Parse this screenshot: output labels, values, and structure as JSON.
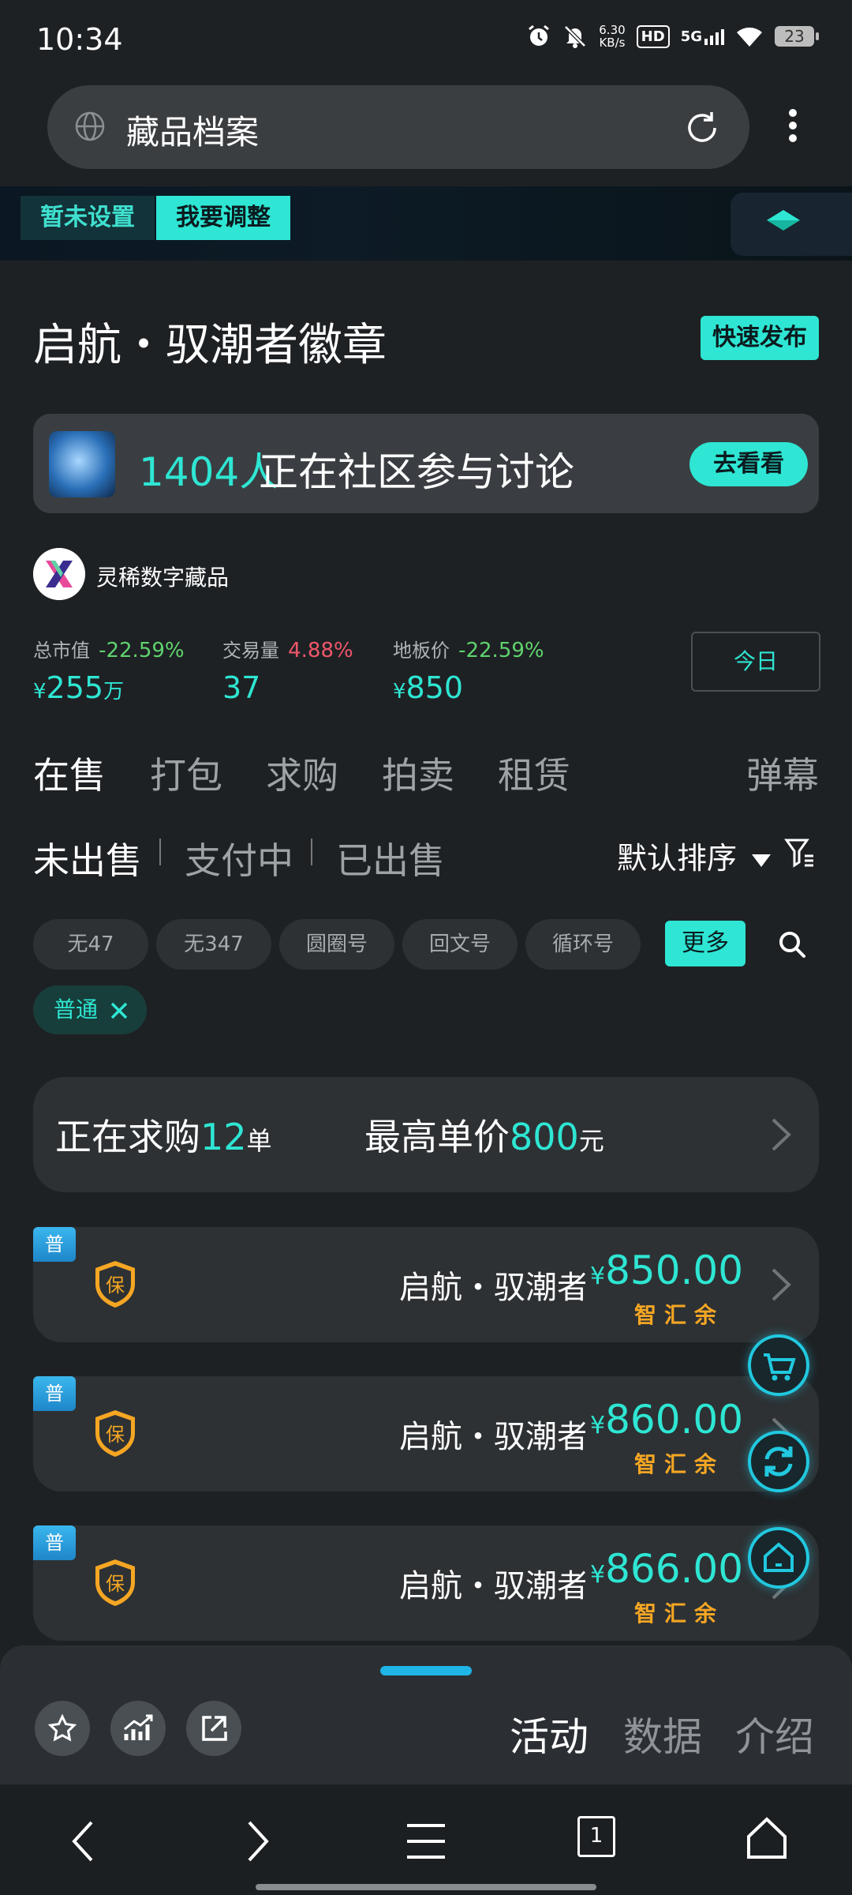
{
  "status_bar": {
    "time": "10:34",
    "net_speed_value": "6.30",
    "net_speed_unit": "KB/s",
    "hd": "HD",
    "signal": "5G",
    "battery": "23",
    "icons": [
      "alarm-icon",
      "mute-icon",
      "hd-icon",
      "5g-signal-icon",
      "wifi-icon",
      "battery-icon"
    ]
  },
  "address_bar": {
    "title": "藏品档案"
  },
  "banner": {
    "not_set_label": "暂未设置",
    "adjust_label": "我要调整"
  },
  "header": {
    "title": "启航・驭潮者徽章",
    "quick_publish": "快速发布"
  },
  "community": {
    "count": "1404人",
    "text": "正在社区参与讨论",
    "go_label": "去看看"
  },
  "issuer": {
    "name": "灵稀数字藏品"
  },
  "stats": {
    "market_cap": {
      "label": "总市值",
      "change": "-22.59%",
      "currency": "¥",
      "value": "255",
      "unit": "万"
    },
    "volume": {
      "label": "交易量",
      "change": "4.88%",
      "value": "37"
    },
    "floor_price": {
      "label": "地板价",
      "change": "-22.59%",
      "currency": "¥",
      "value": "850"
    },
    "period_button": "今日"
  },
  "tabs": {
    "items": [
      "在售",
      "打包",
      "求购",
      "拍卖",
      "租赁"
    ],
    "barrage": "弹幕"
  },
  "subtabs": {
    "items": [
      "未出售",
      "支付中",
      "已出售"
    ],
    "sort_label": "默认排序"
  },
  "filters": {
    "chips": [
      "无47",
      "无347",
      "圆圈号",
      "回文号",
      "循环号"
    ],
    "more": "更多",
    "selected": "普通"
  },
  "buy_requests": {
    "prefix": "正在求购",
    "count": "12",
    "count_unit": "单",
    "max_prefix": "最高单价",
    "max_price": "800",
    "max_unit": "元"
  },
  "listings": [
    {
      "badge": "普",
      "guarantee": "保",
      "name": "启航・驭潮者徽章",
      "currency": "¥",
      "price": "850.00",
      "seller": "智汇余"
    },
    {
      "badge": "普",
      "guarantee": "保",
      "name": "启航・驭潮者徽章",
      "currency": "¥",
      "price": "860.00",
      "seller": "智汇余"
    },
    {
      "badge": "普",
      "guarantee": "保",
      "name": "启航・驭潮者徽章",
      "currency": "¥",
      "price": "866.00",
      "seller": "智汇余"
    }
  ],
  "bottom_panel": {
    "tabs": [
      "活动",
      "数据",
      "介绍"
    ]
  },
  "navbar": {
    "tab_count": "1"
  },
  "colors": {
    "accent": "#2ee6d3",
    "background": "#1e2124",
    "card": "#2d3134",
    "negative_change": "#5fd36d",
    "positive_change": "#f0566b",
    "seller": "#f5a623"
  }
}
